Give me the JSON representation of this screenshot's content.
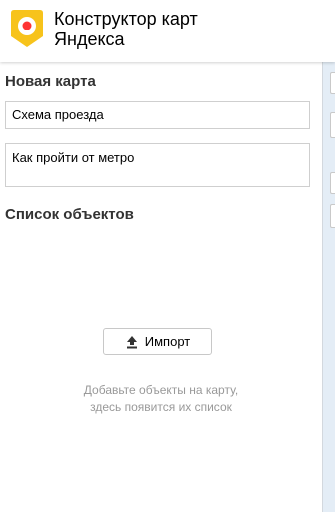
{
  "header": {
    "brand_line1": "Конструктор карт",
    "brand_line2": "Яндекса",
    "logo_icon": "map-pin-logo-icon",
    "logo_color": "#f7c31b",
    "pin_color": "#f33"
  },
  "map_editor": {
    "new_map_title": "Новая карта",
    "name_value": "Схема проезда",
    "description_value": "Как пройти от метро",
    "objects_title": "Список объектов",
    "import_label": "Импорт",
    "import_icon": "upload-icon",
    "empty_hint_line1": "Добавьте объекты на карту,",
    "empty_hint_line2": "здесь появится их список"
  }
}
